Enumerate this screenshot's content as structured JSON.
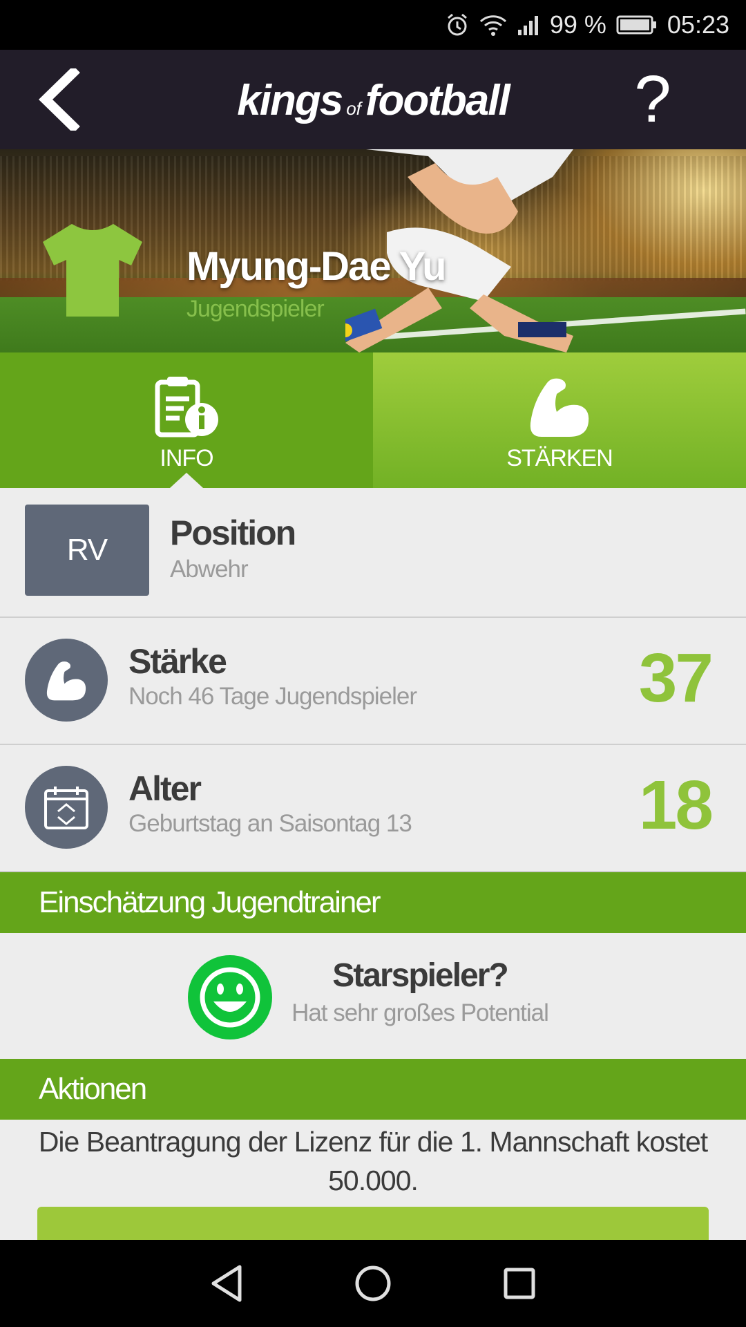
{
  "status_bar": {
    "battery": "99 %",
    "time": "05:23"
  },
  "header": {
    "logo_main1": "kings",
    "logo_of": "of",
    "logo_main2": "football",
    "help_label": "?"
  },
  "player": {
    "name": "Myung-Dae Yu",
    "role": "Jugendspieler",
    "jersey_color": "#8dc63f"
  },
  "tabs": [
    {
      "label": "INFO",
      "active": true
    },
    {
      "label": "STÄRKEN",
      "active": false
    }
  ],
  "position": {
    "code": "RV",
    "title": "Position",
    "subtitle": "Abwehr"
  },
  "strength": {
    "title": "Stärke",
    "subtitle": "Noch 46 Tage Jugendspieler",
    "value": "37"
  },
  "age": {
    "title": "Alter",
    "subtitle": "Geburtstag an Saisontag 13",
    "value": "18"
  },
  "assessment": {
    "section_title": "Einschätzung Jugendtrainer",
    "title": "Starspieler?",
    "subtitle": "Hat sehr großes Potential"
  },
  "actions": {
    "section_title": "Aktionen",
    "text": "Die Beantragung der Lizenz für die 1. Mannschaft kostet 50.000."
  },
  "colors": {
    "accent_green": "#64a51a",
    "value_green": "#8fc33b",
    "smiley_green": "#10c33a",
    "header_bg": "#221d29",
    "badge_gray": "#5f6878"
  }
}
